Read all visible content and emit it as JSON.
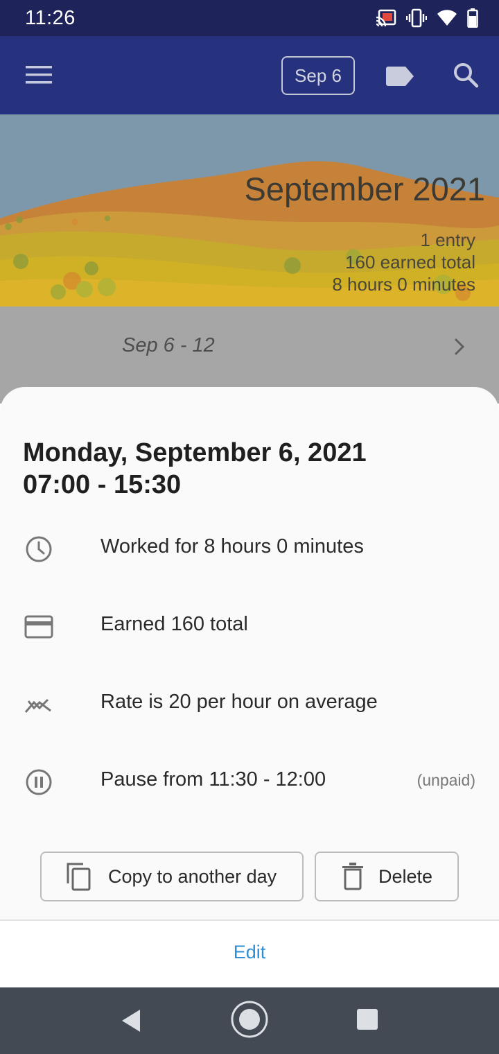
{
  "status_bar": {
    "time": "11:26"
  },
  "app_bar": {
    "date_chip": "Sep 6"
  },
  "banner": {
    "title": "September 2021",
    "stats": [
      "1 entry",
      "160 earned total",
      "8 hours 0 minutes"
    ]
  },
  "week": {
    "label": "Sep 6 - 12"
  },
  "sheet": {
    "date_line": "Monday, September 6, 2021",
    "time_line": "07:00 - 15:30",
    "rows": [
      {
        "icon": "clock-icon",
        "text": "Worked for 8 hours 0 minutes"
      },
      {
        "icon": "credit-card-icon",
        "text": "Earned 160 total"
      },
      {
        "icon": "rate-trend-icon",
        "text": "Rate is 20 per hour on average"
      },
      {
        "icon": "pause-icon",
        "text": "Pause from 11:30 - 12:00",
        "note": "(unpaid)"
      }
    ],
    "copy_label": "Copy to another day",
    "delete_label": "Delete",
    "edit_label": "Edit"
  },
  "colors": {
    "status_bar": "#1e2459",
    "app_bar": "#26327e",
    "edit_accent": "#2f8fd5",
    "sheet_bg": "#fafafa",
    "nav_bar": "#434a53"
  }
}
